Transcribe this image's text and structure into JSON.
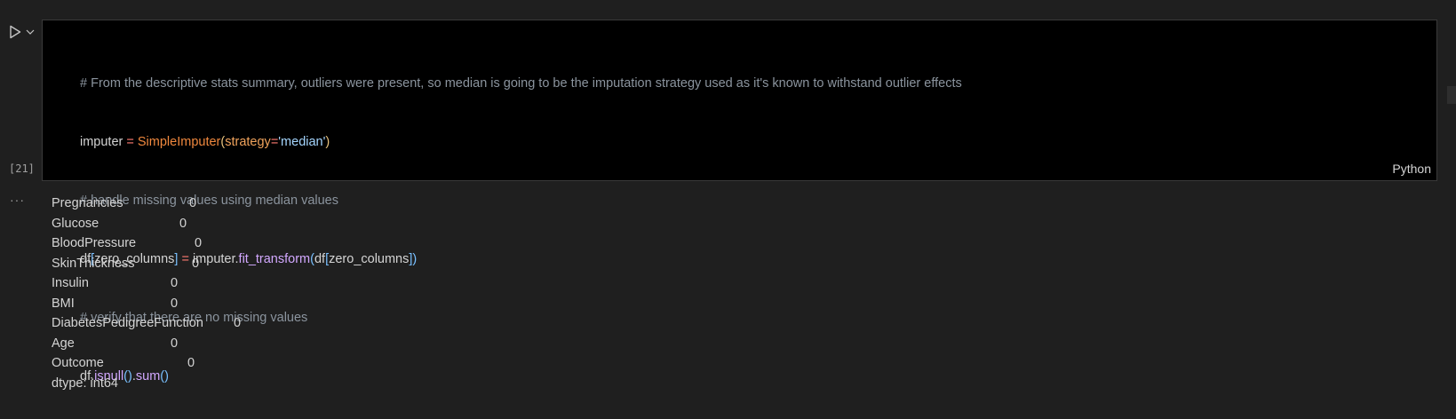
{
  "cell": {
    "execution_count": "[21]",
    "language": "Python",
    "code": {
      "line1": "# From the descriptive stats summary, outliers were present, so median is going to be the imputation strategy used as it's known to withstand outlier effects",
      "line2_var": "imputer",
      "line2_op": " = ",
      "line2_class": "SimpleImputer",
      "line2_open": "(",
      "line2_param": "strategy",
      "line2_eq": "=",
      "line2_str": "'median'",
      "line2_close": ")",
      "line3": "# handle missing values using median values",
      "line4_a": "df",
      "line4_b": "[",
      "line4_c": "zero_columns",
      "line4_d": "]",
      "line4_op": " = ",
      "line4_e": "imputer.",
      "line4_f": "fit_transform",
      "line4_g": "(",
      "line4_h": "df",
      "line4_i": "[",
      "line4_j": "zero_columns",
      "line4_k": "]",
      "line4_l": ")",
      "line5": "# verify that there are no missing values",
      "line6_a": "df.",
      "line6_b": "isnull",
      "line6_c": "()",
      "line6_d": ".",
      "line6_e": "sum",
      "line6_f": "()"
    }
  },
  "output": {
    "menu": "···",
    "rows": [
      {
        "name": "Pregnancies",
        "value": "0"
      },
      {
        "name": "Glucose",
        "value": "0"
      },
      {
        "name": "BloodPressure",
        "value": "0"
      },
      {
        "name": "SkinThickness",
        "value": "0"
      },
      {
        "name": "Insulin",
        "value": "0"
      },
      {
        "name": "BMI",
        "value": "0"
      },
      {
        "name": "DiabetesPedigreeFunction",
        "value": "0"
      },
      {
        "name": "Age",
        "value": "0"
      },
      {
        "name": "Outcome",
        "value": "0"
      }
    ],
    "dtype": "dtype: int64"
  },
  "colors": {
    "background": "#1f1f1f",
    "editor_bg": "#000000",
    "comment": "#8b949e",
    "keyword_class": "#f0883e",
    "string": "#a5d6ff",
    "function": "#d2a8ff"
  },
  "icons": {
    "run": "play-icon",
    "menu": "chevron-down-icon",
    "output_menu": "ellipsis-icon"
  }
}
